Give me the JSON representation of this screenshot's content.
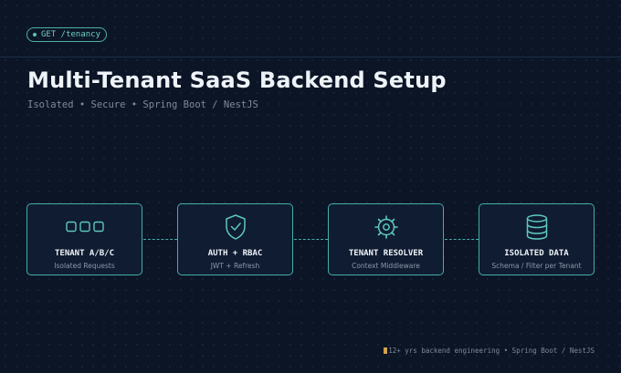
{
  "badge": {
    "text": "GET /tenancy"
  },
  "header": {
    "title": "Multi-Tenant SaaS Backend Setup",
    "subtitle": "Isolated • Secure • Spring Boot / NestJS"
  },
  "flow": {
    "nodes": [
      {
        "icon": "tenant-boxes-icon",
        "label": "TENANT A/B/C",
        "sublabel": "Isolated Requests"
      },
      {
        "icon": "shield-check-icon",
        "label": "AUTH + RBAC",
        "sublabel": "JWT + Refresh"
      },
      {
        "icon": "gear-icon",
        "label": "TENANT RESOLVER",
        "sublabel": "Context Middleware"
      },
      {
        "icon": "database-icon",
        "label": "ISOLATED DATA",
        "sublabel": "Schema / Filter per Tenant"
      }
    ]
  },
  "footer": {
    "text": "12+ yrs backend engineering • Spring Boot / NestJS"
  },
  "colors": {
    "background": "#0c1526",
    "accent": "#44aeaa",
    "node_fill": "#0f1c31",
    "text": "#eef3f8",
    "muted": "#7c8a9c"
  }
}
